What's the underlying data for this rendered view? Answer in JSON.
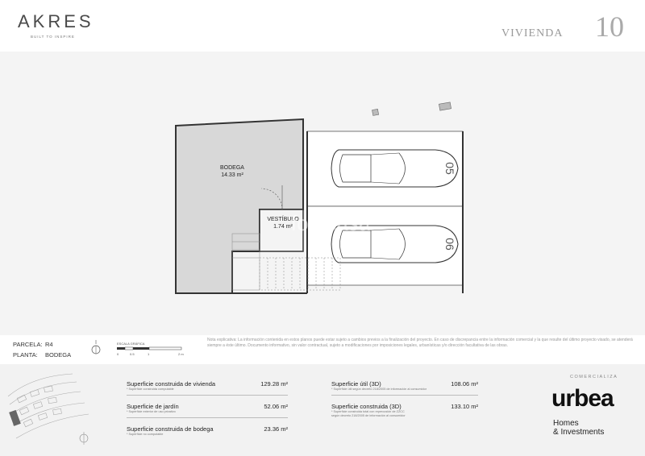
{
  "header": {
    "logo_text": "AKRES",
    "logo_tagline": "BUILT TO INSPIRE",
    "vivienda_label": "VIVIENDA",
    "vivienda_number": "10"
  },
  "plan": {
    "rooms": [
      {
        "name": "BODEGA",
        "area": "14.33 m²"
      },
      {
        "name": "VESTÍBULO",
        "area": "1.74 m²"
      }
    ],
    "parking_numbers": [
      "05",
      "06"
    ],
    "watermark": "fotocasa"
  },
  "info": {
    "parcela_label": "PARCELA:",
    "parcela_value": "R4",
    "planta_label": "PLANTA:",
    "planta_value": "BODEGA",
    "scale_title": "ESCALA GRÁFICA",
    "scale_ticks": [
      "0",
      "0.5",
      "1",
      "2 m"
    ],
    "note": "Nota explicativa: La información contenida en estos planos puede estar sujeto a cambios previos a la finalización del proyecto. En caso de discrepancia entre la información comercial y la que resulte del último proyecto visado, se atenderá siempre a éste último. Documento informativo, sin valor contractual, sujeto a modificaciones por imposiciones legales, urbanísticas y/o dirección facultativa de las obras."
  },
  "superficies_left": [
    {
      "label": "Superficie construida de vivienda",
      "value": "129.28 m²",
      "sub": "* Superficie construida computable"
    },
    {
      "label": "Superficie de jardín",
      "value": "52.06 m²",
      "sub": "* Superficie exterior de uso privativo"
    },
    {
      "label": "Superficie construida de bodega",
      "value": "23.36 m²",
      "sub": "* Superficie no computable"
    }
  ],
  "superficies_right": [
    {
      "label": "Superficie útil (3D)",
      "value": "108.06 m²",
      "sub": "* Superficie útil según decreto 218/2005 de información al consumidor",
      "sub2": ""
    },
    {
      "label": "Superficie construida (3D)",
      "value": "133.10 m²",
      "sub": "* Superficie construida total con repercusión de ZZCC",
      "sub2": "según decreto 218/2005 de información al consumidor"
    }
  ],
  "brand": {
    "comercializa": "COMERCIALIZA",
    "name": "urbea",
    "line1": "Homes",
    "line2": "& Investments"
  }
}
